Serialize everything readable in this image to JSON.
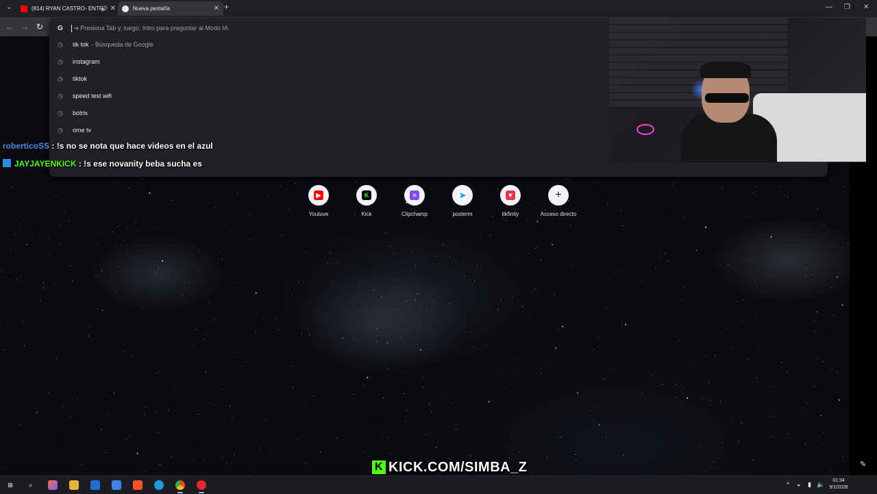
{
  "tabs": [
    {
      "title": "(814) RYAN CASTRO- ENTR",
      "icon": "youtube-icon",
      "active": false
    },
    {
      "title": "Nueva pestaña",
      "icon": "chrome-icon",
      "active": true
    }
  ],
  "omnibox": {
    "placeholder": "Presiona Tab y, luego, Intro para preguntar al Modo IA",
    "g_label": "G",
    "suggestions": [
      {
        "text": "tik tok",
        "desc": "- Búsqueda de Google"
      },
      {
        "text": "instagram",
        "desc": ""
      },
      {
        "text": "tiktok",
        "desc": ""
      },
      {
        "text": "speed test wifi",
        "desc": ""
      },
      {
        "text": "botrix",
        "desc": ""
      },
      {
        "text": "ome tv",
        "desc": ""
      }
    ]
  },
  "chat": [
    {
      "user": "roberticoSS",
      "message": ": !s no se nota que hace videos en el azul"
    },
    {
      "user": "JAYJAYENKICK",
      "message": ": !s ese novanity beba sucha es"
    }
  ],
  "shortcuts": [
    {
      "label": "Youtuve",
      "icon": "youtube-icon",
      "color": "#ff0000"
    },
    {
      "label": "Kick",
      "icon": "kick-icon",
      "color": "#53fc18"
    },
    {
      "label": "Clipchamp",
      "icon": "clipchamp-icon",
      "color": "#7b4dff"
    },
    {
      "label": "posterm",
      "icon": "posterm-icon",
      "color": "#1aa0e8"
    },
    {
      "label": "tikfinity",
      "icon": "tikfinity-icon",
      "color": "#e8364a"
    },
    {
      "label": "Acceso directo",
      "icon": "plus-icon",
      "color": "#202124"
    }
  ],
  "watermark": {
    "text": "KICK.COM/SIMBA_Z",
    "color": "#53fc18"
  },
  "clock": {
    "time": "01:34",
    "date": "9/1/2026"
  }
}
